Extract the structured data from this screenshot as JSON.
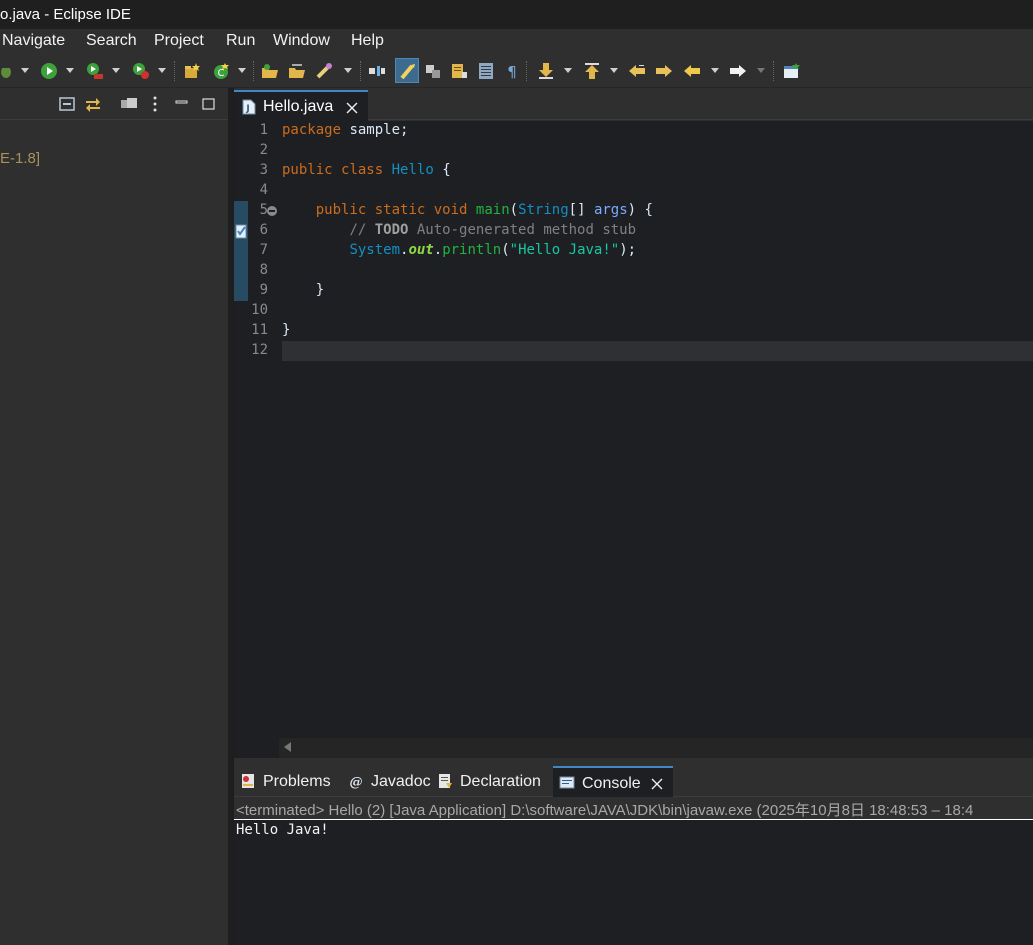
{
  "window": {
    "title": "o.java - Eclipse IDE"
  },
  "menubar": {
    "items": [
      "Navigate",
      "Search",
      "Project",
      "Run",
      "Window",
      "Help"
    ]
  },
  "package_explorer": {
    "tree_label": "E-1.8]"
  },
  "editor": {
    "tab_label": "Hello.java",
    "line_numbers": [
      "1",
      "2",
      "3",
      "4",
      "5",
      "6",
      "7",
      "8",
      "9",
      "10",
      "11",
      "12"
    ],
    "code": {
      "l1_kw": "package",
      "l1_rest": " sample;",
      "l3_kw1": "public",
      "l3_kw2": "class",
      "l3_cls": "Hello",
      "l3_rest": " {",
      "l5_indent": "    ",
      "l5_kw1": "public",
      "l5_kw2": "static",
      "l5_kw3": "void",
      "l5_fn": "main",
      "l5_p1": "(",
      "l5_cls": "String",
      "l5_p2": "[] ",
      "l5_param": "args",
      "l5_p3": ") {",
      "l6_indent": "        ",
      "l6_comment1": "// ",
      "l6_todo": "TODO",
      "l6_comment2": " Auto-generated method stub",
      "l7_indent": "        ",
      "l7_cls": "System",
      "l7_dot1": ".",
      "l7_field": "out",
      "l7_dot2": ".",
      "l7_fn": "println",
      "l7_p1": "(",
      "l7_str": "\"Hello Java!\"",
      "l7_p2": ");",
      "l9_indent": "    ",
      "l9_brace": "}",
      "l11_brace": "}"
    }
  },
  "bottom_panel": {
    "tabs": [
      "Problems",
      "Javadoc",
      "Declaration",
      "Console"
    ],
    "console_status": "<terminated> Hello (2) [Java Application] D:\\software\\JAVA\\JDK\\bin\\javaw.exe  (2025年10月8日 18:48:53 – 18:4",
    "console_output": "Hello Java!"
  }
}
